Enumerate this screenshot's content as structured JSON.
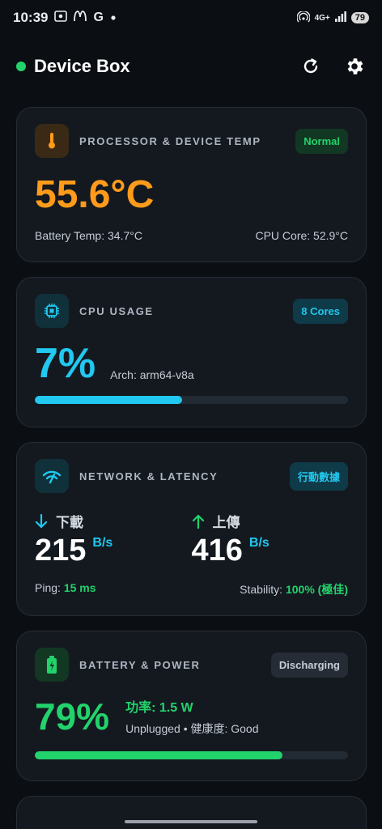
{
  "status_bar": {
    "time": "10:39",
    "left_icons": [
      "screenshot-icon",
      "mcdonalds-icon",
      "google-icon",
      "dot-icon"
    ],
    "network": "4G+",
    "battery": "79"
  },
  "header": {
    "title": "Device Box",
    "status_color": "#22d36b",
    "actions": [
      "refresh-icon",
      "settings-icon"
    ]
  },
  "temp_card": {
    "title": "PROCESSOR & DEVICE TEMP",
    "badge": "Normal",
    "value": "55.6°C",
    "battery_temp": "Battery Temp: 34.7°C",
    "cpu_core": "CPU Core: 52.9°C",
    "icon": "thermometer-icon",
    "accent": "#ff9b1a"
  },
  "cpu_card": {
    "title": "CPU USAGE",
    "badge": "8 Cores",
    "value": "7%",
    "arch": "Arch: arm64-v8a",
    "usage_fraction": 0.47,
    "icon": "chip-icon",
    "accent": "#21c8ef"
  },
  "network_card": {
    "title": "NETWORK & LATENCY",
    "badge": "行動數據",
    "download_label": "下載",
    "download_value": "215",
    "download_unit": "B/s",
    "upload_label": "上傳",
    "upload_value": "416",
    "upload_unit": "B/s",
    "ping_label": "Ping:",
    "ping_value": "15 ms",
    "stability_label": "Stability:",
    "stability_value": "100% (極佳)",
    "icon": "wifi-icon"
  },
  "battery_card": {
    "title": "BATTERY & POWER",
    "badge": "Discharging",
    "value": "79%",
    "power": "功率: 1.5 W",
    "sub": "Unplugged • 健康度: Good",
    "level_fraction": 0.79,
    "icon": "battery-icon",
    "accent": "#22d36b"
  }
}
